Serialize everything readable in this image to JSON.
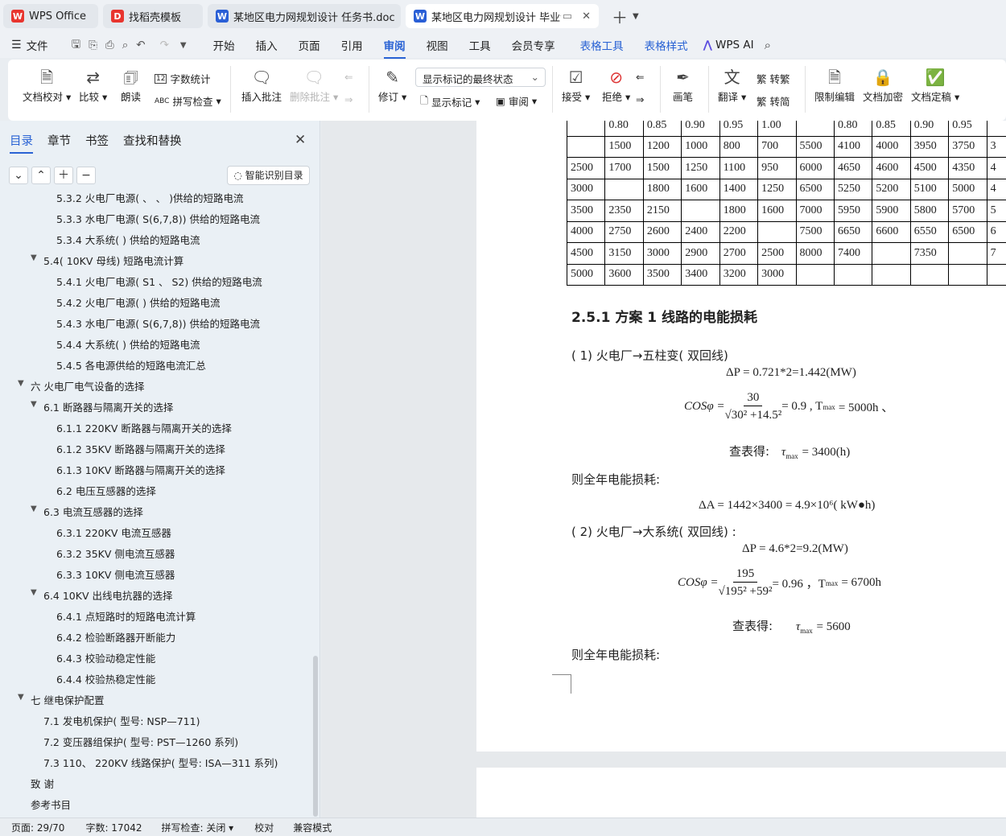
{
  "tabs": [
    {
      "label": "WPS Office",
      "icon": "wps-logo-icon",
      "color": "#e8352f",
      "glyph": "W"
    },
    {
      "label": "找稻壳模板",
      "icon": "docer-icon",
      "color": "#e8352f",
      "glyph": "D"
    },
    {
      "label": "某地区电力网规划设计 任务书.doc",
      "icon": "word-doc-icon",
      "color": "#2a5fd6",
      "glyph": "W"
    },
    {
      "label": "某地区电力网规划设计 毕业论",
      "icon": "word-doc-icon",
      "color": "#2a5fd6",
      "glyph": "W"
    }
  ],
  "menu": {
    "file": "文件",
    "items": [
      "开始",
      "插入",
      "页面",
      "引用",
      "审阅",
      "视图",
      "工具",
      "会员专享"
    ],
    "active": "审阅",
    "table_tools": "表格工具",
    "table_style": "表格样式",
    "wps_ai": "WPS AI"
  },
  "ribbon": {
    "doc_proof": "文档校对",
    "compare": "比较",
    "read_aloud": "朗读",
    "word_count": "字数统计",
    "spell_check": "拼写检查",
    "insert_comment": "插入批注",
    "delete_comment": "删除批注",
    "track_changes": "修订",
    "markup_state": "显示标记的最终状态",
    "show_markup": "显示标记",
    "review": "审阅",
    "accept": "接受",
    "reject": "拒绝",
    "pen": "画笔",
    "translate": "翻译",
    "to_traditional": "转繁",
    "to_simplified": "转简",
    "restrict_edit": "限制编辑",
    "encrypt": "文档加密",
    "finalize": "文档定稿"
  },
  "sidebar": {
    "tabs": [
      "目录",
      "章节",
      "书签",
      "查找和替换"
    ],
    "active_tab": "目录",
    "smart_button": "智能识别目录",
    "toc": [
      {
        "label": "5.3.2 火电厂电源(  、  、  )供给的短路电流",
        "level": 3
      },
      {
        "label": "5.3.3 水电厂电源( S(6,7,8))  供给的短路电流",
        "level": 3
      },
      {
        "label": "5.3.4 大系统( )  供给的短路电流",
        "level": 3
      },
      {
        "label": "5.4( 10KV 母线)  短路电流计算",
        "level": 2,
        "expanded": true
      },
      {
        "label": "5.4.1 火电厂电源( S1  、 S2)  供给的短路电流",
        "level": 3
      },
      {
        "label": "5.4.2 火电厂电源( )  供给的短路电流",
        "level": 3
      },
      {
        "label": "5.4.3 水电厂电源( S(6,7,8))  供给的短路电流",
        "level": 3
      },
      {
        "label": "5.4.4 大系统( )  供给的短路电流",
        "level": 3
      },
      {
        "label": "5.4.5 各电源供给的短路电流汇总",
        "level": 3
      },
      {
        "label": "六   火电厂电气设备的选择",
        "level": 1,
        "expanded": true
      },
      {
        "label": "6.1 断路器与隔离开关的选择",
        "level": 2,
        "expanded": true
      },
      {
        "label": "6.1.1 220KV 断路器与隔离开关的选择",
        "level": 3
      },
      {
        "label": "6.1.2 35KV 断路器与隔离开关的选择",
        "level": 3
      },
      {
        "label": "6.1.3 10KV 断路器与隔离开关的选择",
        "level": 3
      },
      {
        "label": "6.2 电压互感器的选择",
        "level": 3
      },
      {
        "label": "6.3 电流互感器的选择",
        "level": 2,
        "expanded": true
      },
      {
        "label": "6.3.1 220KV 电流互感器",
        "level": 3
      },
      {
        "label": "6.3.2 35KV 侧电流互感器",
        "level": 3
      },
      {
        "label": "6.3.3 10KV 侧电流互感器",
        "level": 3
      },
      {
        "label": "6.4 10KV 出线电抗器的选择",
        "level": 2,
        "expanded": true
      },
      {
        "label": "6.4.1  点短路时的短路电流计算",
        "level": 3
      },
      {
        "label": "6.4.2  检验断路器开断能力",
        "level": 3
      },
      {
        "label": "6.4.3  校验动稳定性能",
        "level": 3
      },
      {
        "label": "6.4.4  校验热稳定性能",
        "level": 3
      },
      {
        "label": "七   继电保护配置",
        "level": 1,
        "expanded": true
      },
      {
        "label": "7.1  发电机保护( 型号: NSP—711)",
        "level": 2
      },
      {
        "label": "7.2  变压器组保护( 型号: PST—1260 系列)",
        "level": 2
      },
      {
        "label": "7.3 110、 220KV 线路保护( 型号: ISA—311 系列)",
        "level": 2
      },
      {
        "label": "致   谢",
        "level": 1
      },
      {
        "label": "参考书目",
        "level": 1
      }
    ]
  },
  "table": {
    "rows": [
      [
        "",
        "0.80",
        "0.85",
        "0.90",
        "0.95",
        "1.00",
        "",
        "0.80",
        "0.85",
        "0.90",
        "0.95",
        ""
      ],
      [
        "",
        "1500",
        "1200",
        "1000",
        "800",
        "700",
        "5500",
        "4100",
        "4000",
        "3950",
        "3750",
        "3"
      ],
      [
        "2500",
        "1700",
        "1500",
        "1250",
        "1100",
        "950",
        "6000",
        "4650",
        "4600",
        "4500",
        "4350",
        "4"
      ],
      [
        "3000",
        "",
        "1800",
        "1600",
        "1400",
        "1250",
        "6500",
        "5250",
        "5200",
        "5100",
        "5000",
        "4"
      ],
      [
        "3500",
        "2350",
        "2150",
        "",
        "1800",
        "1600",
        "7000",
        "5950",
        "5900",
        "5800",
        "5700",
        "5"
      ],
      [
        "4000",
        "2750",
        "2600",
        "2400",
        "2200",
        "",
        "7500",
        "6650",
        "6600",
        "6550",
        "6500",
        "6"
      ],
      [
        "4500",
        "3150",
        "3000",
        "2900",
        "2700",
        "2500",
        "8000",
        "7400",
        "",
        "7350",
        "",
        "7"
      ],
      [
        "5000",
        "3600",
        "3500",
        "3400",
        "3200",
        "3000",
        "",
        "",
        "",
        "",
        "",
        ""
      ]
    ]
  },
  "doc": {
    "heading": "2.5.1 方案 1 线路的电能损耗",
    "item1": "( 1)  火电厂→五柱变( 双回线)",
    "eq1": "ΔP = 0.721*2=1.442(MW)",
    "cos1_num": "30",
    "cos1_den": "√30² +14.5²",
    "cos1_res": "= 0.9 , T",
    "cos1_tail": "= 5000h 、",
    "lookup1_label": "查表得:",
    "lookup1_val": "=  3400(h)",
    "annual_label": "则全年电能损耗:",
    "eq2": "ΔA = 1442×3400 = 4.9×10⁶( kW●h)",
    "item2": "( 2)  火电厂→大系统( 双回线) :",
    "eq3": "ΔP = 4.6*2=9.2(MW)",
    "cos2_num": "195",
    "cos2_den": "√195² +59²",
    "cos2_res": "= 0.96  ，T",
    "cos2_tail": "= 6700h",
    "lookup2_label": "查表得:",
    "lookup2_val": "= 5600",
    "annual_label2": "则全年电能损耗:",
    "cos_label": "COSφ =",
    "tau": "τ",
    "max_sub": "max"
  },
  "status": {
    "page": "页面: 29/70",
    "words": "字数: 17042",
    "spell": "拼写检查: 关闭",
    "proof": "校对",
    "compat": "兼容模式"
  }
}
